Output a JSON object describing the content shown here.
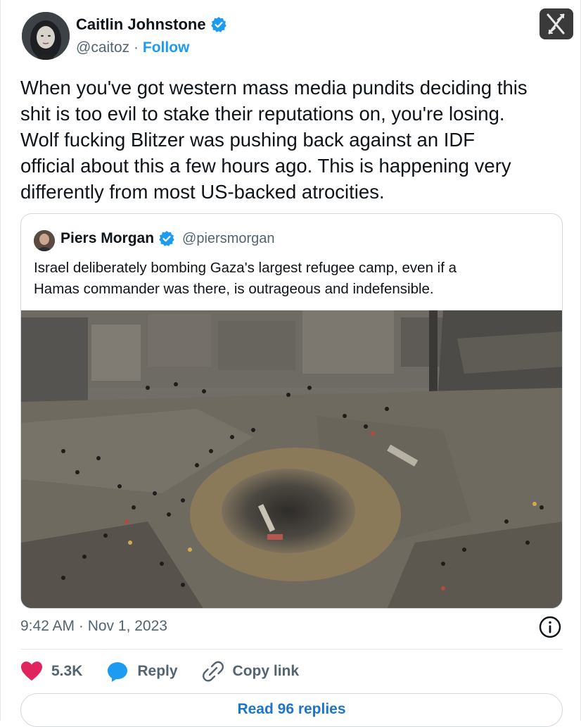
{
  "author": {
    "name": "Caitlin Johnstone",
    "handle": "@caitoz",
    "separator": "·",
    "follow_label": "Follow"
  },
  "tweet_lines": [
    "When you've got western mass media pundits deciding this",
    "shit is too evil to stake their reputations on, you're losing.",
    "Wolf fucking Blitzer was pushing back against an IDF",
    "official about this a few hours ago. This is happening very",
    "differently from most US-backed atrocities."
  ],
  "quoted": {
    "name": "Piers Morgan",
    "handle": "@piersmorgan",
    "text_lines": [
      "Israel deliberately bombing Gaza's largest refugee camp, even if a",
      "Hamas commander was there, is outrageous and indefensible."
    ]
  },
  "timestamp": "9:42 AM · Nov 1, 2023",
  "actions": {
    "likes": "5.3K",
    "reply_label": "Reply",
    "copy_link_label": "Copy link"
  },
  "read_replies_label": "Read 96 replies",
  "colors": {
    "accent": "#1d9bf0",
    "like": "#e0245e",
    "text": "#0f1419",
    "secondary": "#536471"
  },
  "icons": [
    "verified-badge-icon",
    "x-logo-icon",
    "info-icon",
    "heart-icon",
    "reply-bubble-icon",
    "link-icon"
  ]
}
